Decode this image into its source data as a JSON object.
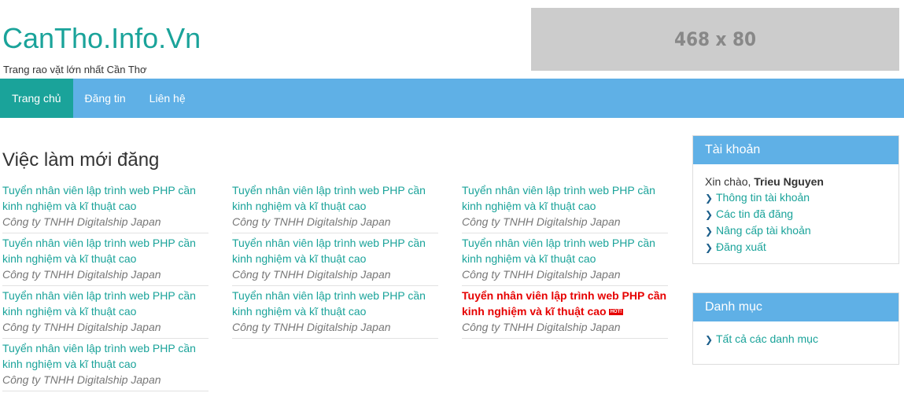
{
  "site": {
    "logo": "CanTho.Info.Vn",
    "tagline": "Trang rao vặt lớn nhất Cần Thơ",
    "ad_label": "468 x 80"
  },
  "nav": {
    "items": [
      {
        "label": "Trang chủ",
        "active": true
      },
      {
        "label": "Đăng tin",
        "active": false
      },
      {
        "label": "Liên hệ",
        "active": false
      }
    ]
  },
  "main": {
    "section_title": "Việc làm mới đăng",
    "jobs": [
      {
        "title": "Tuyển nhân viên lập trình web PHP cần kinh nghiệm và kĩ thuật cao",
        "company": "Công ty TNHH Digitalship Japan",
        "hot": false
      },
      {
        "title": "Tuyển nhân viên lập trình web PHP cần kinh nghiệm và kĩ thuật cao",
        "company": "Công ty TNHH Digitalship Japan",
        "hot": false
      },
      {
        "title": "Tuyển nhân viên lập trình web PHP cần kinh nghiệm và kĩ thuật cao",
        "company": "Công ty TNHH Digitalship Japan",
        "hot": false
      },
      {
        "title": "Tuyển nhân viên lập trình web PHP cần kinh nghiệm và kĩ thuật cao",
        "company": "Công ty TNHH Digitalship Japan",
        "hot": false
      },
      {
        "title": "Tuyển nhân viên lập trình web PHP cần kinh nghiệm và kĩ thuật cao",
        "company": "Công ty TNHH Digitalship Japan",
        "hot": false
      },
      {
        "title": "Tuyển nhân viên lập trình web PHP cần kinh nghiệm và kĩ thuật cao",
        "company": "Công ty TNHH Digitalship Japan",
        "hot": false
      },
      {
        "title": "Tuyển nhân viên lập trình web PHP cần kinh nghiệm và kĩ thuật cao",
        "company": "Công ty TNHH Digitalship Japan",
        "hot": false
      },
      {
        "title": "Tuyển nhân viên lập trình web PHP cần kinh nghiệm và kĩ thuật cao",
        "company": "Công ty TNHH Digitalship Japan",
        "hot": false
      },
      {
        "title": "Tuyển nhân viên lập trình web PHP cần kinh nghiệm và kĩ thuật cao",
        "company": "Công ty TNHH Digitalship Japan",
        "hot": true,
        "badge": "HOT!"
      },
      {
        "title": "Tuyển nhân viên lập trình web PHP cần kinh nghiệm và kĩ thuật cao",
        "company": "Công ty TNHH Digitalship Japan",
        "hot": false
      }
    ]
  },
  "account_panel": {
    "heading": "Tài khoản",
    "greeting_prefix": "Xin chào,",
    "username": "Trieu Nguyen",
    "links": [
      "Thông tin tài khoản",
      "Các tin đã đăng",
      "Nâng cấp tài khoản",
      "Đăng xuất"
    ]
  },
  "category_panel": {
    "heading": "Danh mục",
    "links": [
      "Tất cả các danh mục"
    ]
  },
  "colors": {
    "brand": "#1aa39a",
    "navbar": "#5fb0e6",
    "hot": "#e60000",
    "ad_bg": "#cccccc"
  }
}
